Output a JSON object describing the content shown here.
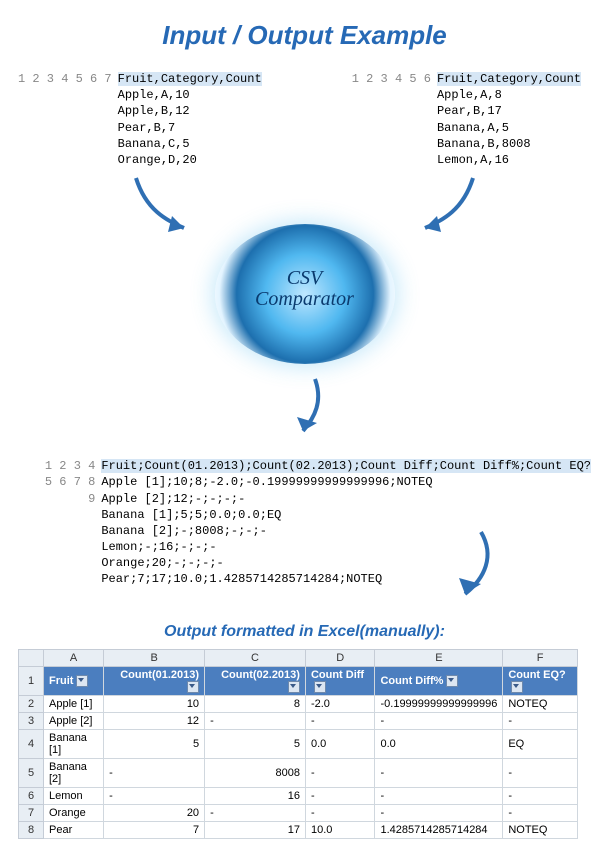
{
  "title": "Input / Output Example",
  "logo_line1": "CSV",
  "logo_line2": "Comparator",
  "subtitle": "Output formatted in Excel(manually):",
  "input_left": {
    "nums": "1\n2\n3\n4\n5\n6\n7",
    "hl": "Fruit,Category,Count",
    "rest": "\nApple,A,10\nApple,B,12\nPear,B,7\nBanana,C,5\nOrange,D,20\n"
  },
  "input_right": {
    "nums": "1\n2\n3\n4\n5\n6",
    "hl": "Fruit,Category,Count",
    "rest": "\nApple,A,8\nPear,B,17\nBanana,A,5\nBanana,B,8008\nLemon,A,16"
  },
  "output": {
    "nums": "1\n2\n3\n4\n5\n6\n7\n8\n9",
    "hl": "Fruit;Count(01.2013);Count(02.2013);Count Diff;Count Diff%;Count EQ?",
    "rest": "\nApple [1];10;8;-2.0;-0.19999999999999996;NOTEQ\nApple [2];12;-;-;-;-\nBanana [1];5;5;0.0;0.0;EQ\nBanana [2];-;8008;-;-;-\nLemon;-;16;-;-;-\nOrange;20;-;-;-;-\nPear;7;17;10.0;1.4285714285714284;NOTEQ\n"
  },
  "excel": {
    "cols": [
      "",
      "A",
      "B",
      "C",
      "D",
      "E",
      "F"
    ],
    "headers": [
      "Fruit",
      "Count(01.2013)",
      "Count(02.2013)",
      "Count Diff",
      "Count Diff%",
      "Count EQ?"
    ],
    "r2": [
      "2",
      "Apple [1]",
      "10",
      "8",
      "-2.0",
      "-0.19999999999999996",
      "NOTEQ"
    ],
    "r3": [
      "3",
      "Apple [2]",
      "12",
      "-",
      "-",
      "-",
      "-"
    ],
    "r4": [
      "4",
      "Banana [1]",
      "5",
      "5",
      "0.0",
      "0.0",
      "EQ"
    ],
    "r5": [
      "5",
      "Banana [2]",
      "-",
      "8008",
      "-",
      "-",
      "-"
    ],
    "r6": [
      "6",
      "Lemon",
      "-",
      "16",
      "-",
      "-",
      "-"
    ],
    "r7": [
      "7",
      "Orange",
      "20",
      "-",
      "-",
      "-",
      "-"
    ],
    "r8": [
      "8",
      "Pear",
      "7",
      "17",
      "10.0",
      "1.4285714285714284",
      "NOTEQ"
    ]
  }
}
